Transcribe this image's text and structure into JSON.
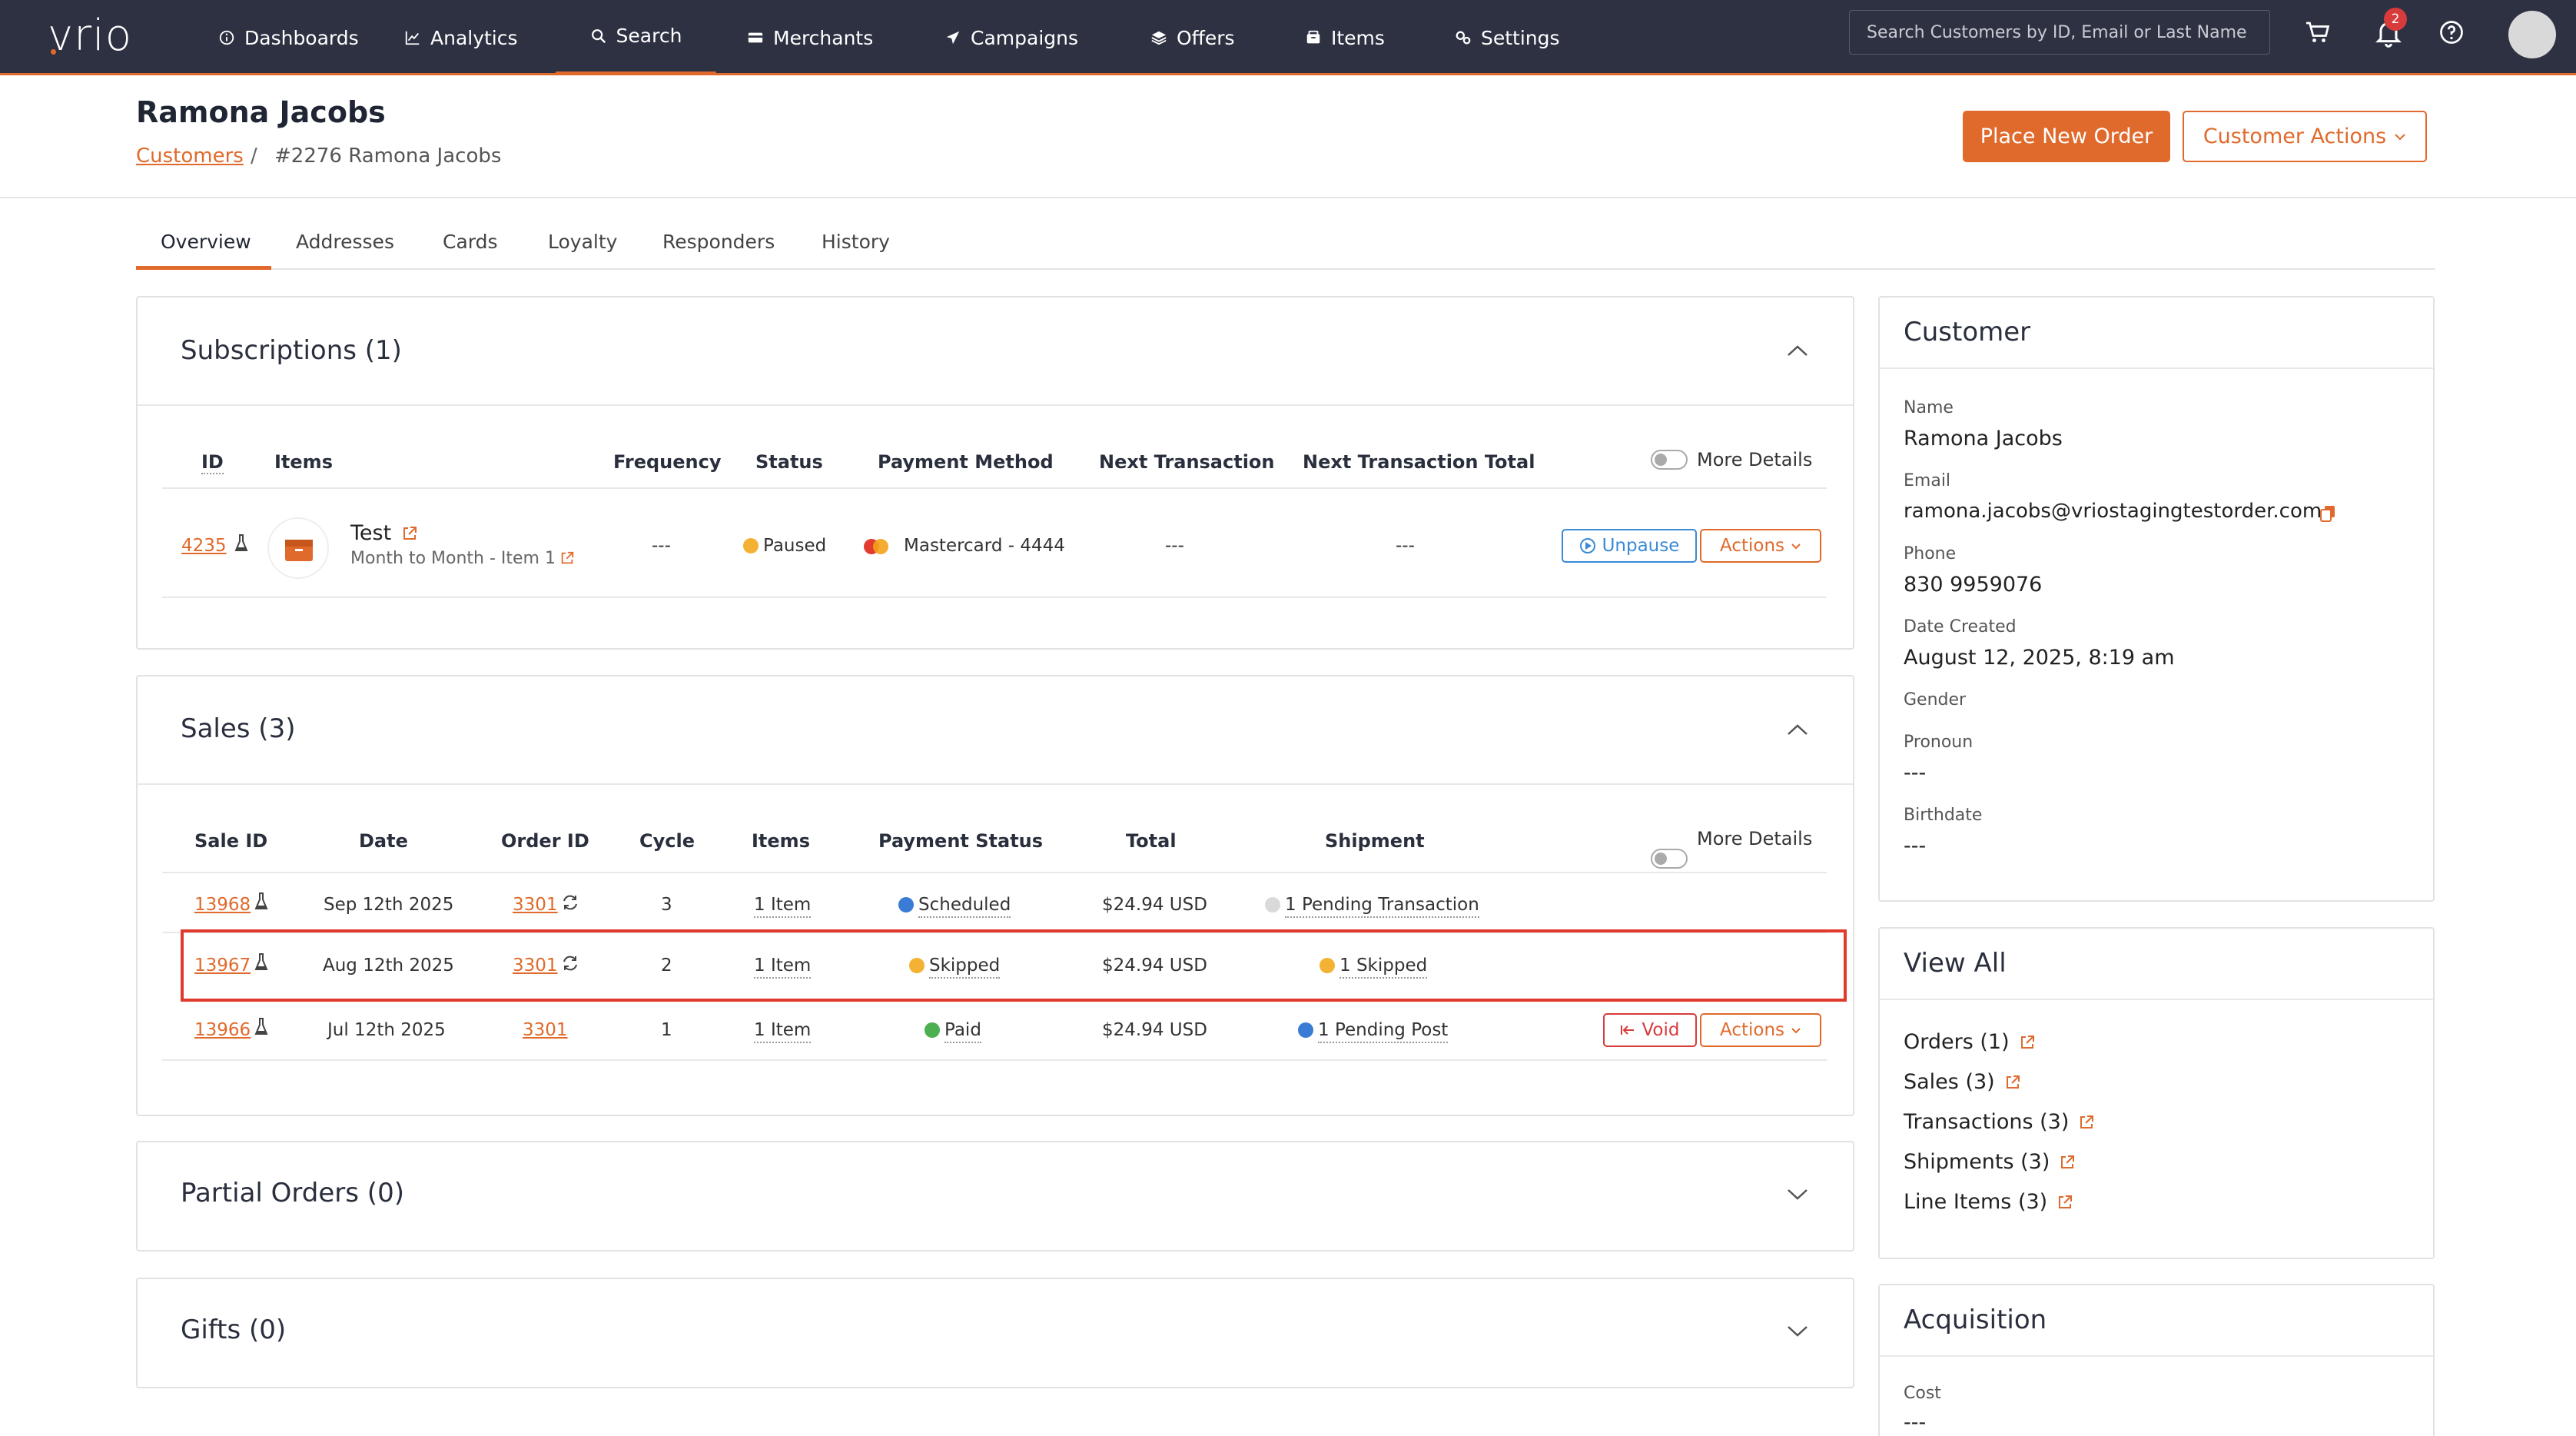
{
  "app": {
    "logo": "vrio"
  },
  "nav": {
    "items": [
      {
        "label": "Dashboards",
        "icon": "info-circle-icon"
      },
      {
        "label": "Analytics",
        "icon": "line-chart-icon"
      },
      {
        "label": "Search",
        "icon": "search-icon"
      },
      {
        "label": "Merchants",
        "icon": "card-icon"
      },
      {
        "label": "Campaigns",
        "icon": "send-icon"
      },
      {
        "label": "Offers",
        "icon": "layers-icon"
      },
      {
        "label": "Items",
        "icon": "box-icon"
      },
      {
        "label": "Settings",
        "icon": "gears-icon"
      }
    ],
    "active": "Search",
    "search_placeholder": "Search Customers by ID, Email or Last Name",
    "notification_count": "2"
  },
  "page": {
    "title": "Ramona Jacobs",
    "breadcrumb_link": "Customers",
    "breadcrumb_sep": "/",
    "breadcrumb_current": "#2276 Ramona Jacobs",
    "place_order_label": "Place New Order",
    "customer_actions_label": "Customer Actions"
  },
  "tabs": [
    "Overview",
    "Addresses",
    "Cards",
    "Loyalty",
    "Responders",
    "History"
  ],
  "subscriptions": {
    "title": "Subscriptions (1)",
    "headers": {
      "id": "ID",
      "items": "Items",
      "frequency": "Frequency",
      "status": "Status",
      "payment": "Payment Method",
      "next": "Next Transaction",
      "next_total": "Next Transaction Total",
      "more": "More Details"
    },
    "row": {
      "id": "4235",
      "item_name": "Test",
      "item_sub": "Month to Month - Item 1",
      "frequency": "---",
      "status": "Paused",
      "payment": "Mastercard - 4444",
      "next": "---",
      "next_total": "---",
      "unpause_label": "Unpause",
      "actions_label": "Actions"
    }
  },
  "sales": {
    "title": "Sales (3)",
    "headers": {
      "sale_id": "Sale ID",
      "date": "Date",
      "order_id": "Order ID",
      "cycle": "Cycle",
      "items": "Items",
      "payment_status": "Payment Status",
      "total": "Total",
      "shipment": "Shipment",
      "more": "More Details"
    },
    "rows": [
      {
        "sale_id": "13968",
        "date": "Sep 12th 2025",
        "order_id": "3301",
        "cycle": "3",
        "items": "1 Item",
        "payment_status": "Scheduled",
        "status_color": "#3a7bd5",
        "total": "$24.94 USD",
        "shipment": "1 Pending Transaction",
        "ship_color": "#d9d9d9"
      },
      {
        "sale_id": "13967",
        "date": "Aug 12th 2025",
        "order_id": "3301",
        "cycle": "2",
        "items": "1 Item",
        "payment_status": "Skipped",
        "status_color": "#f3b234",
        "total": "$24.94 USD",
        "shipment": "1 Skipped",
        "ship_color": "#f3b234"
      },
      {
        "sale_id": "13966",
        "date": "Jul 12th 2025",
        "order_id": "3301",
        "cycle": "1",
        "items": "1 Item",
        "payment_status": "Paid",
        "status_color": "#4caf50",
        "total": "$24.94 USD",
        "shipment": "1 Pending Post",
        "ship_color": "#3a7bd5"
      }
    ],
    "void_label": "Void",
    "actions_label": "Actions"
  },
  "partial_orders": {
    "title": "Partial Orders (0)"
  },
  "gifts": {
    "title": "Gifts (0)"
  },
  "customer": {
    "title": "Customer",
    "name_label": "Name",
    "name": "Ramona Jacobs",
    "email_label": "Email",
    "email": "ramona.jacobs@vriostagingtestorder.com",
    "phone_label": "Phone",
    "phone": "830 9959076",
    "date_label": "Date Created",
    "date": "August 12, 2025, 8:19 am",
    "gender_label": "Gender",
    "pronoun_label": "Pronoun",
    "pronoun": "---",
    "birthdate_label": "Birthdate",
    "birthdate": "---"
  },
  "view_all": {
    "title": "View All",
    "links": [
      "Orders (1)",
      "Sales (3)",
      "Transactions (3)",
      "Shipments (3)",
      "Line Items (3)"
    ]
  },
  "acquisition": {
    "title": "Acquisition",
    "cost_label": "Cost",
    "cost": "---"
  },
  "colors": {
    "accent": "#e06a2c",
    "nav_bg": "#2e3142",
    "highlight": "#e03a2c"
  }
}
